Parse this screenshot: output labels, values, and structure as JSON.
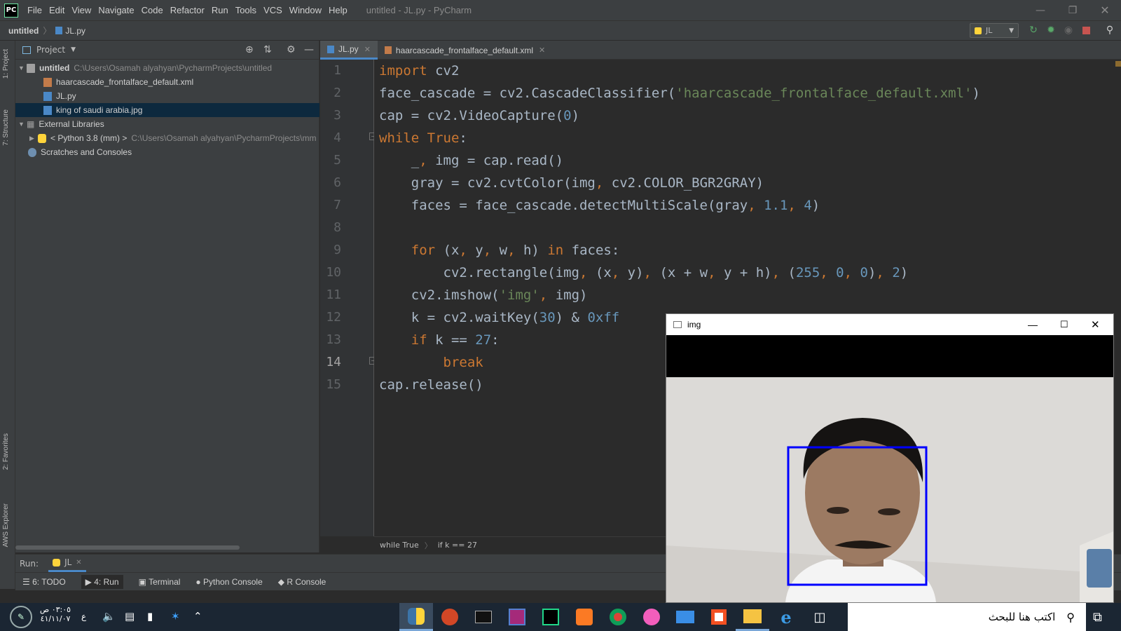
{
  "menubar": {
    "logo": "PC",
    "items": [
      "File",
      "Edit",
      "View",
      "Navigate",
      "Code",
      "Refactor",
      "Run",
      "Tools",
      "VCS",
      "Window",
      "Help"
    ],
    "title": "untitled - JL.py - PyCharm"
  },
  "navbar": {
    "project": "untitled",
    "file": "JL.py",
    "run_config": "JL"
  },
  "left_stripe": {
    "project": "1: Project",
    "structure": "7: Structure",
    "favorites": "2: Favorites",
    "aws": "AWS Explorer"
  },
  "project_panel": {
    "title": "Project",
    "root": {
      "name": "untitled",
      "path": "C:\\Users\\Osamah alyahyan\\PycharmProjects\\untitled"
    },
    "files": [
      "haarcascade_frontalface_default.xml",
      "JL.py",
      "king of saudi arabia.jpg"
    ],
    "external": "External Libraries",
    "python": {
      "name": "< Python 3.8 (mm) >",
      "path": "C:\\Users\\Osamah alyahyan\\PycharmProjects\\mm"
    },
    "scratches": "Scratches and Consoles"
  },
  "tabs": [
    {
      "label": "JL.py"
    },
    {
      "label": "haarcascade_frontalface_default.xml"
    }
  ],
  "line_numbers": [
    "1",
    "2",
    "3",
    "4",
    "5",
    "6",
    "7",
    "8",
    "9",
    "10",
    "11",
    "12",
    "13",
    "14",
    "15"
  ],
  "code": {
    "l1": {
      "kw": "import",
      "rest": " cv2"
    },
    "l2": {
      "a": "face_cascade = cv2.CascadeClassifier(",
      "str": "'haarcascade_frontalface_default.xml'",
      "b": ")"
    },
    "l3": {
      "a": "cap = cv2.VideoCapture(",
      "num": "0",
      "b": ")"
    },
    "l4": {
      "kw": "while",
      "kw2": " True",
      "b": ":"
    },
    "l5": {
      "a": "    _",
      "c": ",",
      "b": " img = cap.read()"
    },
    "l6": {
      "a": "    gray = cv2.cvtColor(img",
      "c": ",",
      "b": " cv2.COLOR_BGR2GRAY)"
    },
    "l7": {
      "a": "    faces = face_cascade.detectMultiScale(gray",
      "c1": ",",
      "n1": " 1.1",
      "c2": ",",
      "n2": " 4",
      "b": ")"
    },
    "l9": {
      "kw": "    for",
      "a": " (x",
      "c1": ",",
      "b": " y",
      "c2": ",",
      "d": " w",
      "c3": ",",
      "e": " h) ",
      "kw2": "in",
      "f": " faces:"
    },
    "l10": {
      "a": "        cv2.rectangle(img",
      "c1": ",",
      "b": " (x",
      "c2": ",",
      "d": " y)",
      "c3": ",",
      "e": " (x + w",
      "c4": ",",
      "f": " y + h)",
      "c5": ",",
      "g": " (",
      "n1": "255",
      "c6": ",",
      "n2": " 0",
      "c7": ",",
      "n3": " 0",
      "h": ")",
      "c8": ",",
      "n4": " 2",
      "i": ")"
    },
    "l11": {
      "a": "    cv2.imshow(",
      "str": "'img'",
      "c": ",",
      "b": " img)"
    },
    "l12": {
      "a": "    k = cv2.waitKey(",
      "n1": "30",
      "b": ") & ",
      "n2": "0xff"
    },
    "l13": {
      "kw": "    if",
      "a": " k == ",
      "num": "27",
      "b": ":"
    },
    "l14": {
      "kw": "        break"
    },
    "l15": {
      "a": "cap.release()"
    }
  },
  "breadcrumb": {
    "first": "while True",
    "second": "if k == 27"
  },
  "run_bar": {
    "label": "Run:",
    "tab": "JL"
  },
  "tools": [
    "6: TODO",
    "4: Run",
    "Terminal",
    "Python Console",
    "R Console"
  ],
  "img_window": {
    "title": "img"
  },
  "taskbar": {
    "search_placeholder": "اكتب هنا للبحث",
    "time": "٠٣:٠٥ ص",
    "date": "٤١/١١/٠٧",
    "lang": "ع"
  },
  "colors": {
    "keyword": "#cc7832",
    "string": "#6a8759",
    "number": "#6897bb",
    "face_box": "#0000ff"
  }
}
